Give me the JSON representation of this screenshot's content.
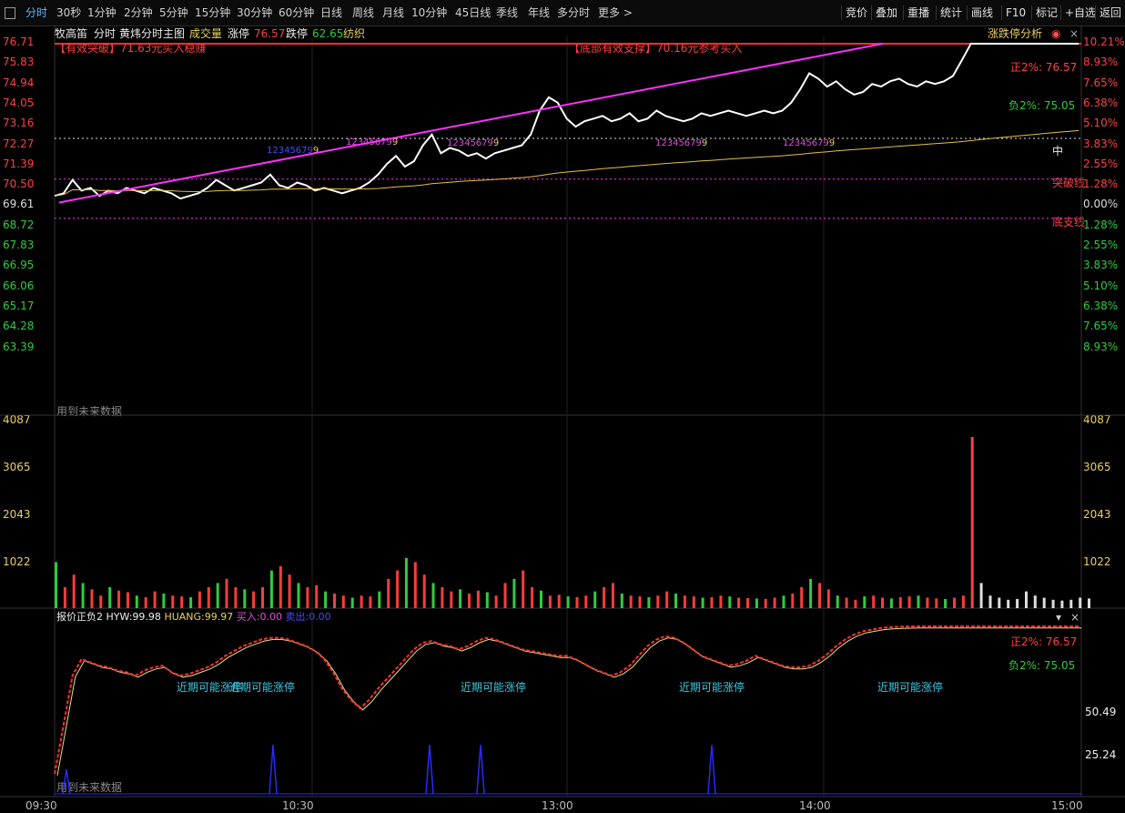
{
  "toolbar": {
    "timeframes": [
      "分时",
      "30秒",
      "1分钟",
      "2分钟",
      "5分钟",
      "15分钟",
      "30分钟",
      "60分钟",
      "日线",
      "周线",
      "月线",
      "10分钟",
      "45日线",
      "季线",
      "年线",
      "多分时",
      "更多 >"
    ],
    "right_buttons": [
      "竞价",
      "叠加",
      "重播",
      "统计",
      "画线",
      "F10",
      "标记",
      "+自选",
      "返回"
    ]
  },
  "header": {
    "stock": "牧高笛",
    "mode": "分时",
    "indicator": "黄炜分时主图",
    "volume_label": "成交量",
    "up_limit_label": "涨停",
    "up_limit_value": "76.57",
    "down_limit_label": "跌停",
    "down_limit_value": "62.65",
    "textile": "纺织",
    "analysis": "涨跌停分析"
  },
  "annotations": {
    "breakout_tag": "【有效突破】",
    "breakout_text": "71.63元买入稳赚",
    "support_tag": "【底部有效支撑】",
    "support_text": "70.16元参考买入",
    "pos2": "正2%: 76.57",
    "neg2": "负2%: 75.05",
    "mid": "中",
    "breakout_line": "突破线",
    "bottom_line": "底支线",
    "future": "用到未来数据",
    "seq": "12345679",
    "seq_tag": "9"
  },
  "price_axis": {
    "left": [
      "76.71",
      "75.83",
      "74.94",
      "74.05",
      "73.16",
      "72.27",
      "71.39",
      "70.50",
      "69.61",
      "68.72",
      "67.83",
      "66.95",
      "66.06",
      "65.17",
      "64.28",
      "63.39"
    ],
    "right": [
      "10.21%",
      "8.93%",
      "7.65%",
      "6.38%",
      "5.10%",
      "3.83%",
      "2.55%",
      "1.28%",
      "0.00%",
      "1.28%",
      "2.55%",
      "3.83%",
      "5.10%",
      "6.38%",
      "7.65%",
      "8.93%"
    ]
  },
  "volume_axis": [
    "4087",
    "3065",
    "2043",
    "1022"
  ],
  "indicator_panel": {
    "title": "报价正负2",
    "hyw_label": "HYW:",
    "hyw": "99.98",
    "huang_label": "HUANG:",
    "huang": "99.97",
    "buy_label": "买入:",
    "buy": "0.00",
    "sell_label": "卖出:",
    "sell": "0.00",
    "pos2": "正2%: 76.57",
    "neg2": "负2%: 75.05",
    "limit_text": "近期可能涨停",
    "axis": [
      "50.49",
      "25.24"
    ],
    "future": "用到未来数据"
  },
  "time_axis": [
    "09:30",
    "10:30",
    "13:00",
    "14:00",
    "15:00"
  ],
  "colors": {
    "up": "#ff3b3b",
    "down": "#2ecc40",
    "price": "#ffffff",
    "avg": "#e8c040",
    "trend": "#ff30ff",
    "pos": "#ff3030",
    "neg": "#2ecc40"
  },
  "chart_data": {
    "type": "line",
    "title": "",
    "price_series": [
      71.0,
      71.1,
      71.6,
      71.2,
      71.3,
      71.0,
      71.2,
      71.1,
      71.3,
      71.2,
      71.1,
      71.3,
      71.2,
      71.1,
      70.9,
      71.0,
      71.1,
      71.3,
      71.6,
      71.4,
      71.2,
      71.3,
      71.4,
      71.5,
      71.8,
      71.4,
      71.3,
      71.5,
      71.4,
      71.2,
      71.3,
      71.2,
      71.1,
      71.2,
      71.3,
      71.5,
      71.8,
      72.2,
      72.5,
      72.1,
      72.3,
      72.9,
      73.3,
      72.6,
      72.8,
      72.7,
      72.5,
      72.6,
      72.4,
      72.6,
      72.7,
      72.8,
      72.9,
      73.3,
      74.2,
      74.7,
      74.5,
      73.9,
      73.6,
      73.8,
      73.9,
      74.0,
      73.8,
      73.9,
      74.1,
      73.8,
      73.9,
      74.2,
      74.0,
      73.9,
      73.8,
      73.9,
      74.1,
      74.0,
      74.1,
      74.2,
      74.1,
      74.0,
      74.1,
      74.2,
      74.1,
      74.2,
      74.5,
      75.0,
      75.6,
      75.4,
      75.1,
      75.3,
      75.0,
      74.8,
      74.9,
      75.2,
      75.1,
      75.3,
      75.4,
      75.2,
      75.1,
      75.3,
      75.2,
      75.3,
      75.5,
      76.1,
      76.71,
      76.71,
      76.71,
      76.71,
      76.71,
      76.71,
      76.71,
      76.71,
      76.71,
      76.71,
      76.71,
      76.71,
      76.71
    ],
    "volume": [
      1100,
      500,
      800,
      600,
      450,
      300,
      500,
      420,
      380,
      300,
      260,
      400,
      350,
      300,
      280,
      260,
      400,
      500,
      600,
      700,
      500,
      450,
      400,
      500,
      900,
      1000,
      800,
      600,
      500,
      550,
      400,
      350,
      300,
      250,
      300,
      280,
      400,
      700,
      900,
      1200,
      1100,
      800,
      600,
      500,
      400,
      450,
      350,
      420,
      380,
      300,
      600,
      700,
      900,
      500,
      420,
      300,
      320,
      280,
      260,
      300,
      400,
      500,
      600,
      350,
      300,
      280,
      260,
      300,
      400,
      350,
      300,
      280,
      250,
      260,
      300,
      280,
      250,
      240,
      230,
      220,
      250,
      300,
      350,
      500,
      700,
      600,
      450,
      300,
      250,
      200,
      280,
      300,
      250,
      230,
      260,
      280,
      300,
      250,
      230,
      220,
      250,
      300,
      4087,
      600,
      300,
      250,
      200,
      220,
      400,
      300,
      250,
      200,
      180,
      200,
      250,
      230
    ],
    "osc_hyw": [
      10,
      40,
      70,
      80,
      78,
      76,
      75,
      73,
      72,
      70,
      73,
      75,
      76,
      72,
      70,
      71,
      73,
      75,
      78,
      82,
      85,
      88,
      90,
      92,
      93,
      93,
      92,
      90,
      88,
      85,
      80,
      72,
      62,
      55,
      50,
      55,
      62,
      68,
      74,
      80,
      86,
      90,
      91,
      89,
      88,
      86,
      88,
      91,
      93,
      92,
      90,
      88,
      86,
      85,
      84,
      83,
      82,
      82,
      80,
      77,
      74,
      72,
      70,
      72,
      76,
      82,
      88,
      92,
      94,
      93,
      90,
      86,
      82,
      80,
      78,
      76,
      77,
      79,
      82,
      80,
      78,
      76,
      75,
      75,
      76,
      79,
      83,
      88,
      92,
      95,
      97,
      98,
      99,
      99.5,
      99.8,
      99.9,
      99.98,
      99.98,
      99.98,
      99.98,
      99.98,
      99.98,
      99.98,
      99.98,
      99.98,
      99.98,
      99.98,
      99.98,
      99.98,
      99.98,
      99.98,
      99.98,
      99.98,
      99.98,
      99.98
    ]
  }
}
